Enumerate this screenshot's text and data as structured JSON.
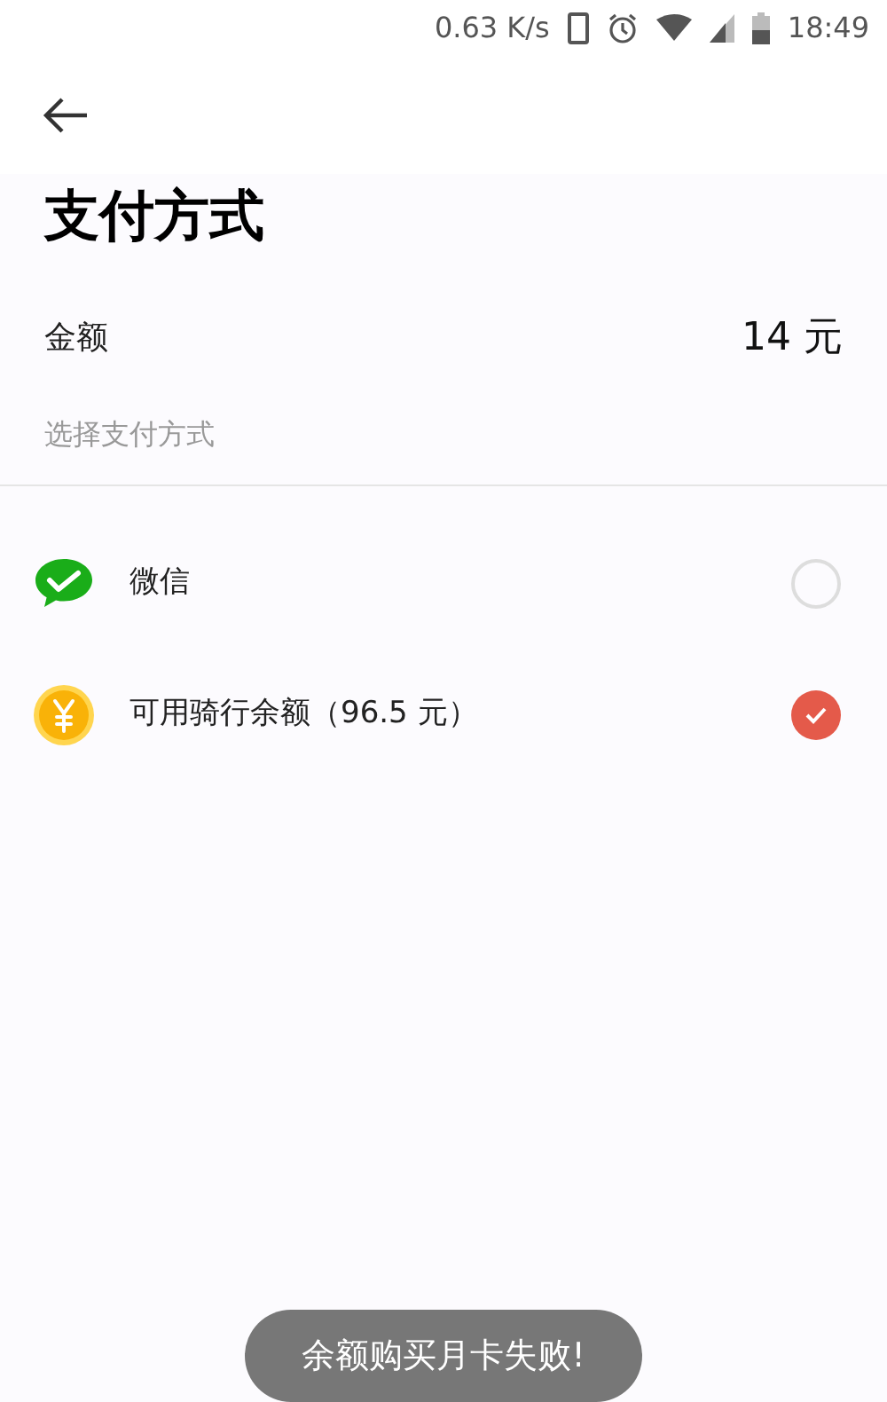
{
  "status_bar": {
    "speed": "0.63 K/s",
    "time": "18:49"
  },
  "title": "支付方式",
  "amount": {
    "label": "金额",
    "value": "14 元"
  },
  "section_label": "选择支付方式",
  "options": [
    {
      "kind": "wechat",
      "label": "微信",
      "selected": false
    },
    {
      "kind": "balance",
      "label": "可用骑行余额（96.5 元）",
      "selected": true
    }
  ],
  "toast": "余额购买月卡失败!"
}
